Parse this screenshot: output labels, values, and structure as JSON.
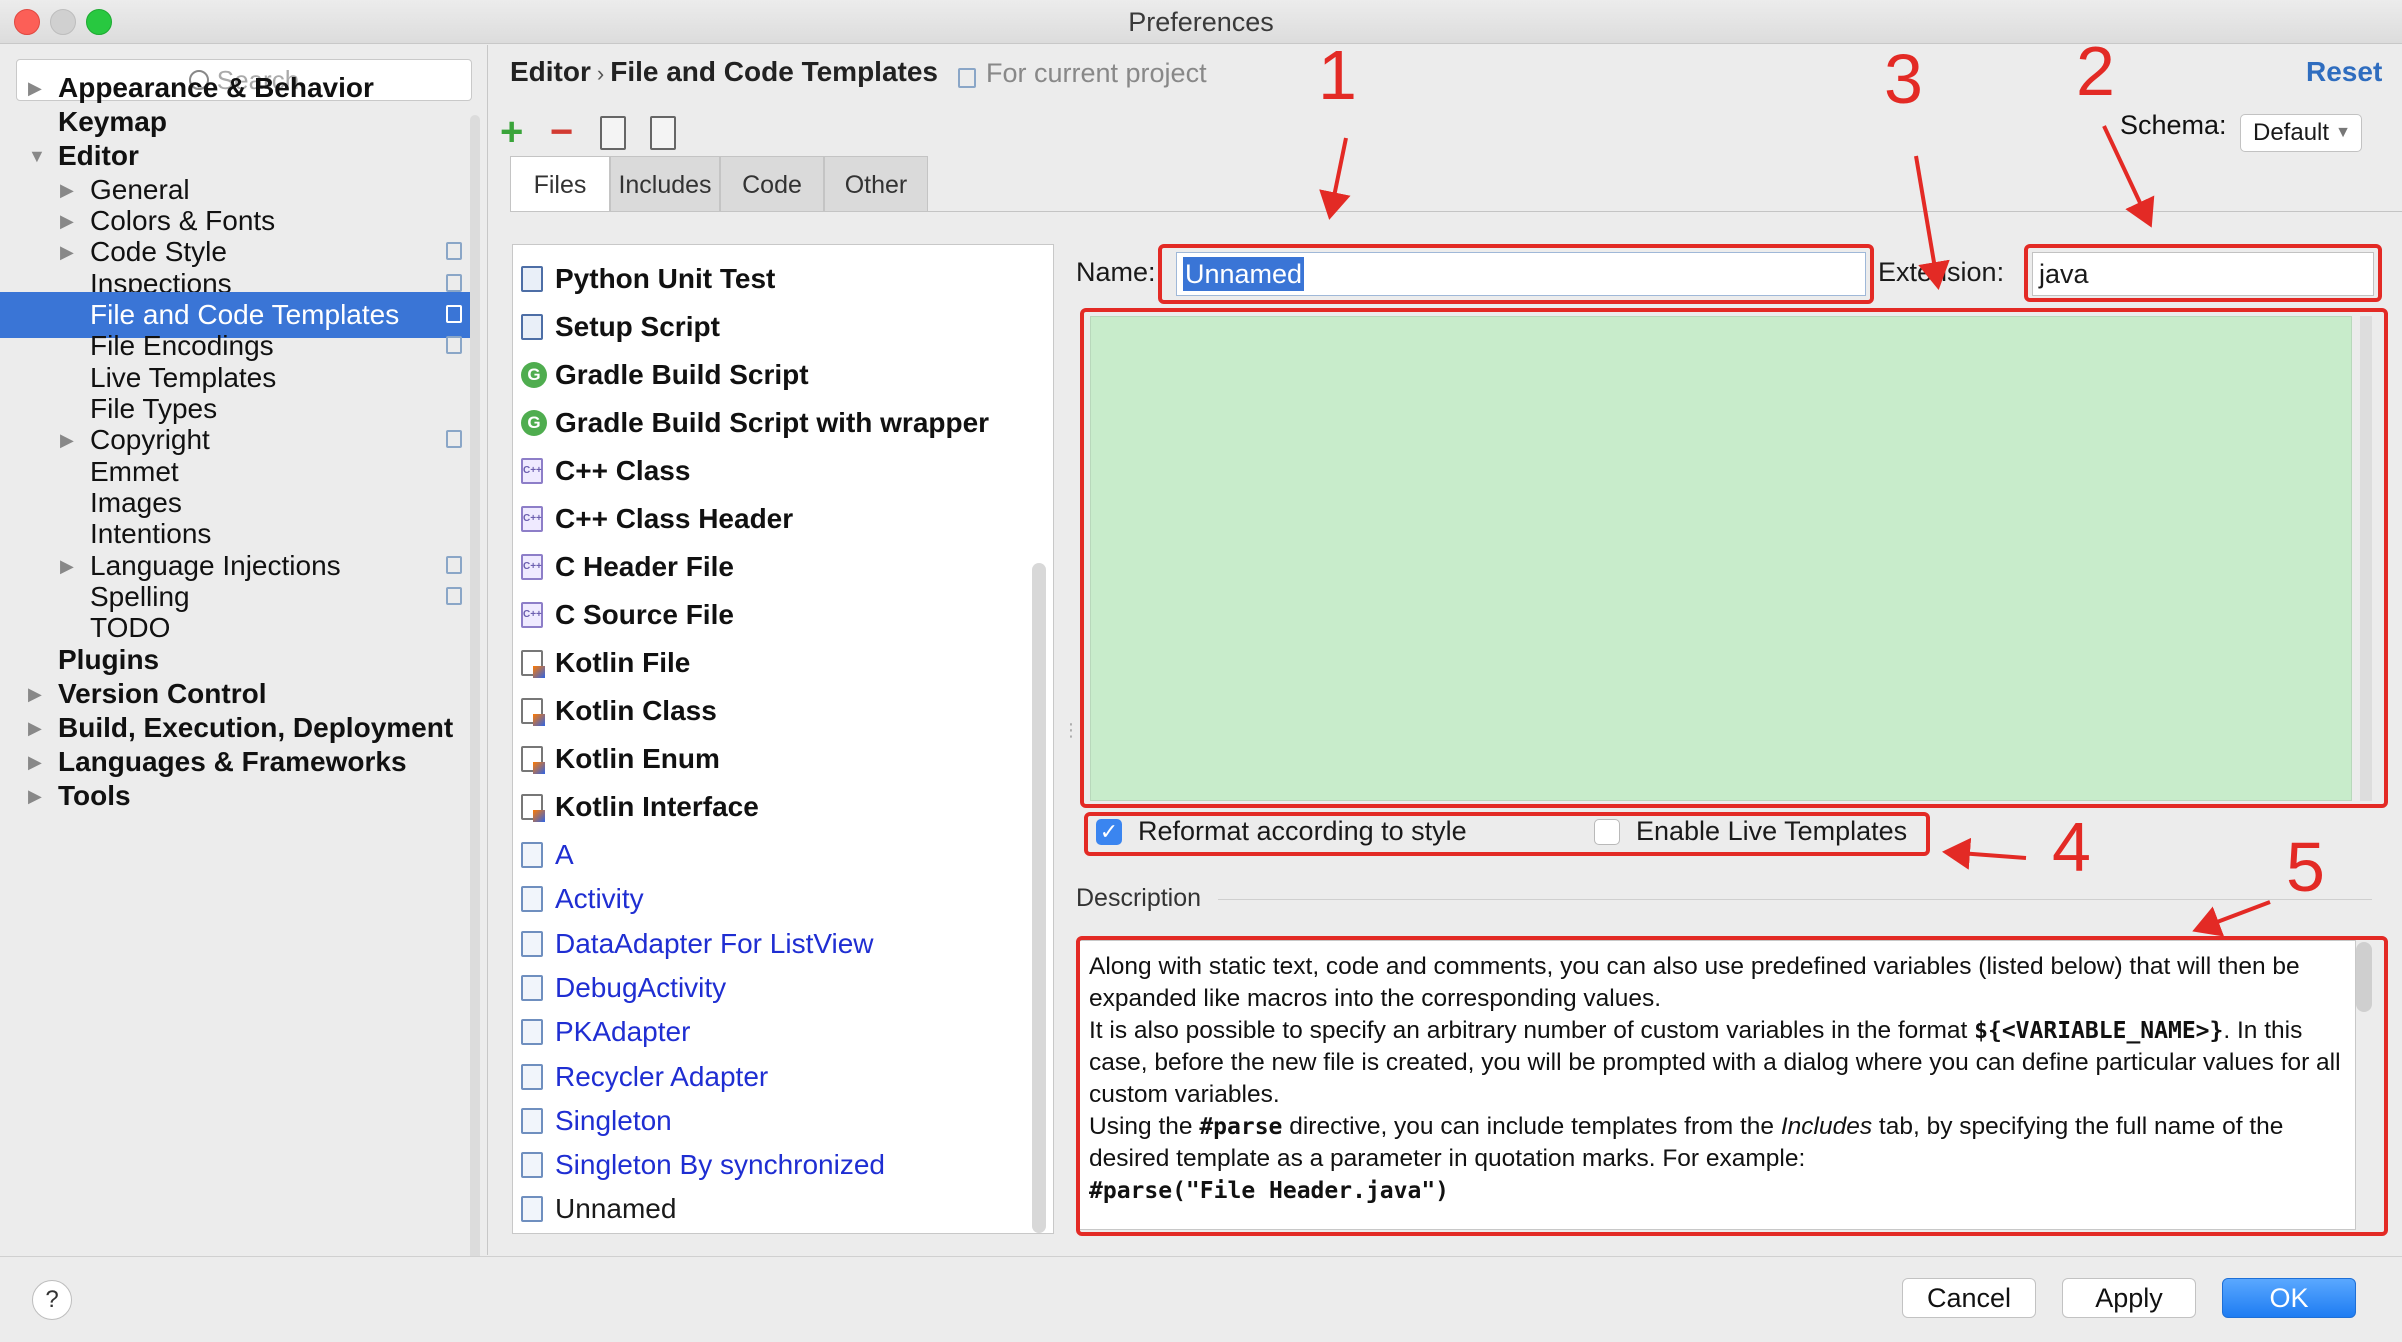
{
  "window": {
    "title": "Preferences"
  },
  "sidebar": {
    "search_placeholder": "Search",
    "items": [
      {
        "label": "Appearance & Behavior",
        "level": 0,
        "bold": true,
        "expander": "collapsed"
      },
      {
        "label": "Keymap",
        "level": 0,
        "bold": true,
        "expander": "none"
      },
      {
        "label": "Editor",
        "level": 0,
        "bold": true,
        "expander": "expanded"
      },
      {
        "label": "General",
        "level": 1,
        "bold": false,
        "expander": "collapsed"
      },
      {
        "label": "Colors & Fonts",
        "level": 1,
        "bold": false,
        "expander": "collapsed"
      },
      {
        "label": "Code Style",
        "level": 1,
        "bold": false,
        "expander": "collapsed",
        "project": true
      },
      {
        "label": "Inspections",
        "level": 1,
        "bold": false,
        "expander": "none",
        "project": true
      },
      {
        "label": "File and Code Templates",
        "level": 1,
        "bold": false,
        "expander": "none",
        "project": true,
        "selected": true
      },
      {
        "label": "File Encodings",
        "level": 1,
        "bold": false,
        "expander": "none",
        "project": true
      },
      {
        "label": "Live Templates",
        "level": 1,
        "bold": false,
        "expander": "none"
      },
      {
        "label": "File Types",
        "level": 1,
        "bold": false,
        "expander": "none"
      },
      {
        "label": "Copyright",
        "level": 1,
        "bold": false,
        "expander": "collapsed",
        "project": true
      },
      {
        "label": "Emmet",
        "level": 1,
        "bold": false,
        "expander": "none"
      },
      {
        "label": "Images",
        "level": 1,
        "bold": false,
        "expander": "none"
      },
      {
        "label": "Intentions",
        "level": 1,
        "bold": false,
        "expander": "none"
      },
      {
        "label": "Language Injections",
        "level": 1,
        "bold": false,
        "expander": "collapsed",
        "project": true
      },
      {
        "label": "Spelling",
        "level": 1,
        "bold": false,
        "expander": "none",
        "project": true
      },
      {
        "label": "TODO",
        "level": 1,
        "bold": false,
        "expander": "none"
      },
      {
        "label": "Plugins",
        "level": 0,
        "bold": true,
        "expander": "none"
      },
      {
        "label": "Version Control",
        "level": 0,
        "bold": true,
        "expander": "collapsed"
      },
      {
        "label": "Build, Execution, Deployment",
        "level": 0,
        "bold": true,
        "expander": "collapsed"
      },
      {
        "label": "Languages & Frameworks",
        "level": 0,
        "bold": true,
        "expander": "collapsed"
      },
      {
        "label": "Tools",
        "level": 0,
        "bold": true,
        "expander": "collapsed"
      }
    ]
  },
  "header": {
    "breadcrumb_parent": "Editor",
    "breadcrumb_sep": "›",
    "breadcrumb_current": "File and Code Templates",
    "scope": "For current project",
    "reset": "Reset",
    "schema_label": "Schema:",
    "schema_value": "Default"
  },
  "toolbar": {
    "add": "+",
    "remove": "−"
  },
  "tabs": [
    "Files",
    "Includes",
    "Code",
    "Other"
  ],
  "templates": [
    {
      "label": "Python Unit Test",
      "icon": "python-file-icon",
      "style": "bold"
    },
    {
      "label": "Setup Script",
      "icon": "python-file-icon",
      "style": "bold"
    },
    {
      "label": "Gradle Build Script",
      "icon": "gradle-icon",
      "style": "bold"
    },
    {
      "label": "Gradle Build Script with wrapper",
      "icon": "gradle-icon",
      "style": "bold"
    },
    {
      "label": "C++ Class",
      "icon": "cpp-file-icon",
      "style": "bold"
    },
    {
      "label": "C++ Class Header",
      "icon": "cpp-file-icon",
      "style": "bold"
    },
    {
      "label": "C Header File",
      "icon": "cpp-file-icon",
      "style": "bold"
    },
    {
      "label": "C Source File",
      "icon": "cpp-file-icon",
      "style": "bold"
    },
    {
      "label": "Kotlin File",
      "icon": "kotlin-file-icon",
      "style": "bold"
    },
    {
      "label": "Kotlin Class",
      "icon": "kotlin-file-icon",
      "style": "bold"
    },
    {
      "label": "Kotlin Enum",
      "icon": "kotlin-file-icon",
      "style": "bold"
    },
    {
      "label": "Kotlin Interface",
      "icon": "kotlin-file-icon",
      "style": "bold"
    },
    {
      "label": "A",
      "icon": "template-file-icon",
      "style": "blue"
    },
    {
      "label": "Activity",
      "icon": "template-file-icon",
      "style": "blue"
    },
    {
      "label": "DataAdapter For ListView",
      "icon": "template-file-icon",
      "style": "blue"
    },
    {
      "label": "DebugActivity",
      "icon": "template-file-icon",
      "style": "blue"
    },
    {
      "label": "PKAdapter",
      "icon": "template-file-icon",
      "style": "blue"
    },
    {
      "label": "Recycler Adapter",
      "icon": "template-file-icon",
      "style": "blue"
    },
    {
      "label": "Singleton",
      "icon": "template-file-icon",
      "style": "blue"
    },
    {
      "label": "Singleton By synchronized",
      "icon": "template-file-icon",
      "style": "blue"
    },
    {
      "label": "Unnamed",
      "icon": "template-file-icon",
      "style": "selected"
    }
  ],
  "form": {
    "name_label": "Name:",
    "name_value": "Unnamed",
    "extension_label": "Extension:",
    "extension_value": "java",
    "reformat_label": "Reformat according to style",
    "reformat_checked": true,
    "live_templates_label": "Enable Live Templates",
    "live_templates_checked": false
  },
  "description": {
    "label": "Description",
    "p1": "Along with static text, code and comments, you can also use predefined variables (listed below) that will then be expanded like macros into the corresponding values.",
    "p2a": "It is also possible to specify an arbitrary number of custom variables in the format ",
    "p2code": "${<VARIABLE_NAME>}",
    "p2b": ". In this case, before the new file is created, you will be prompted with a dialog where you can define particular values for all custom variables.",
    "p3a": "Using the ",
    "p3code": "#parse",
    "p3b": " directive, you can include templates from the ",
    "p3em": "Includes",
    "p3c": " tab, by specifying the full name of the desired template as a parameter in quotation marks. For example:",
    "p4code": "#parse(\"File Header.java\")"
  },
  "buttons": {
    "help": "?",
    "cancel": "Cancel",
    "apply": "Apply",
    "ok": "OK"
  },
  "annotations": [
    "1",
    "2",
    "3",
    "4",
    "5"
  ],
  "colors": {
    "selection": "#3a75d6",
    "accent": "#2f6dbf",
    "annotation": "#e32a25",
    "editor_bg": "#c8eccb"
  }
}
